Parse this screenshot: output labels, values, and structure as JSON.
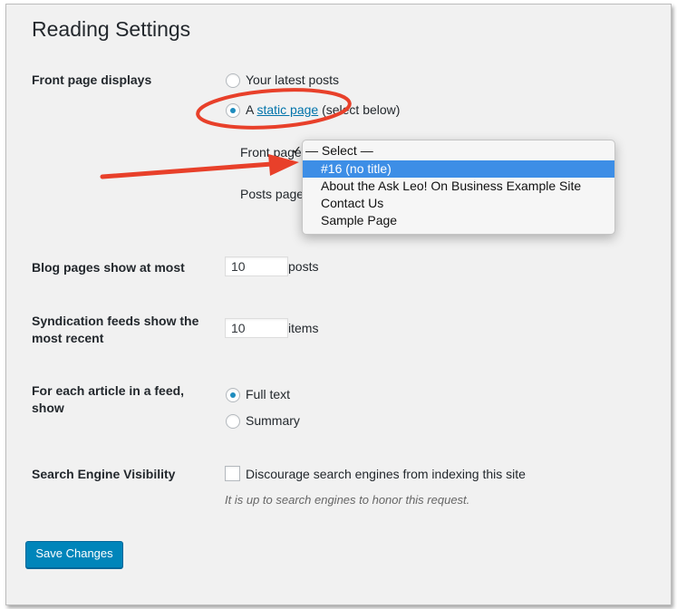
{
  "page": {
    "title": "Reading Settings"
  },
  "front_page_displays": {
    "label": "Front page displays",
    "option_latest": "Your latest posts",
    "option_static_prefix": "A",
    "option_static_link": "static page",
    "option_static_suffix": "(select below)",
    "selected": "static",
    "front_page_label": "Front page",
    "posts_page_label": "Posts page",
    "dropdown": {
      "checkmark": "✓",
      "placeholder": "— Select —",
      "options": [
        "#16 (no title)",
        "About the Ask Leo! On Business Example Site",
        "Contact Us",
        "Sample Page"
      ],
      "highlighted": "#16 (no title)"
    }
  },
  "blog_pages": {
    "label": "Blog pages show at most",
    "value": "10",
    "suffix": "posts"
  },
  "syndication": {
    "label": "Syndication feeds show the most recent",
    "value": "10",
    "suffix": "items"
  },
  "feed_article": {
    "label": "For each article in a feed, show",
    "option_full": "Full text",
    "option_summary": "Summary",
    "selected": "full"
  },
  "search_visibility": {
    "label": "Search Engine Visibility",
    "checkbox_label": "Discourage search engines from indexing this site",
    "checked": false,
    "note": "It is up to search engines to honor this request."
  },
  "save_button": "Save Changes",
  "annotation_color": "#e8402a",
  "accent_color": "#0085ba"
}
